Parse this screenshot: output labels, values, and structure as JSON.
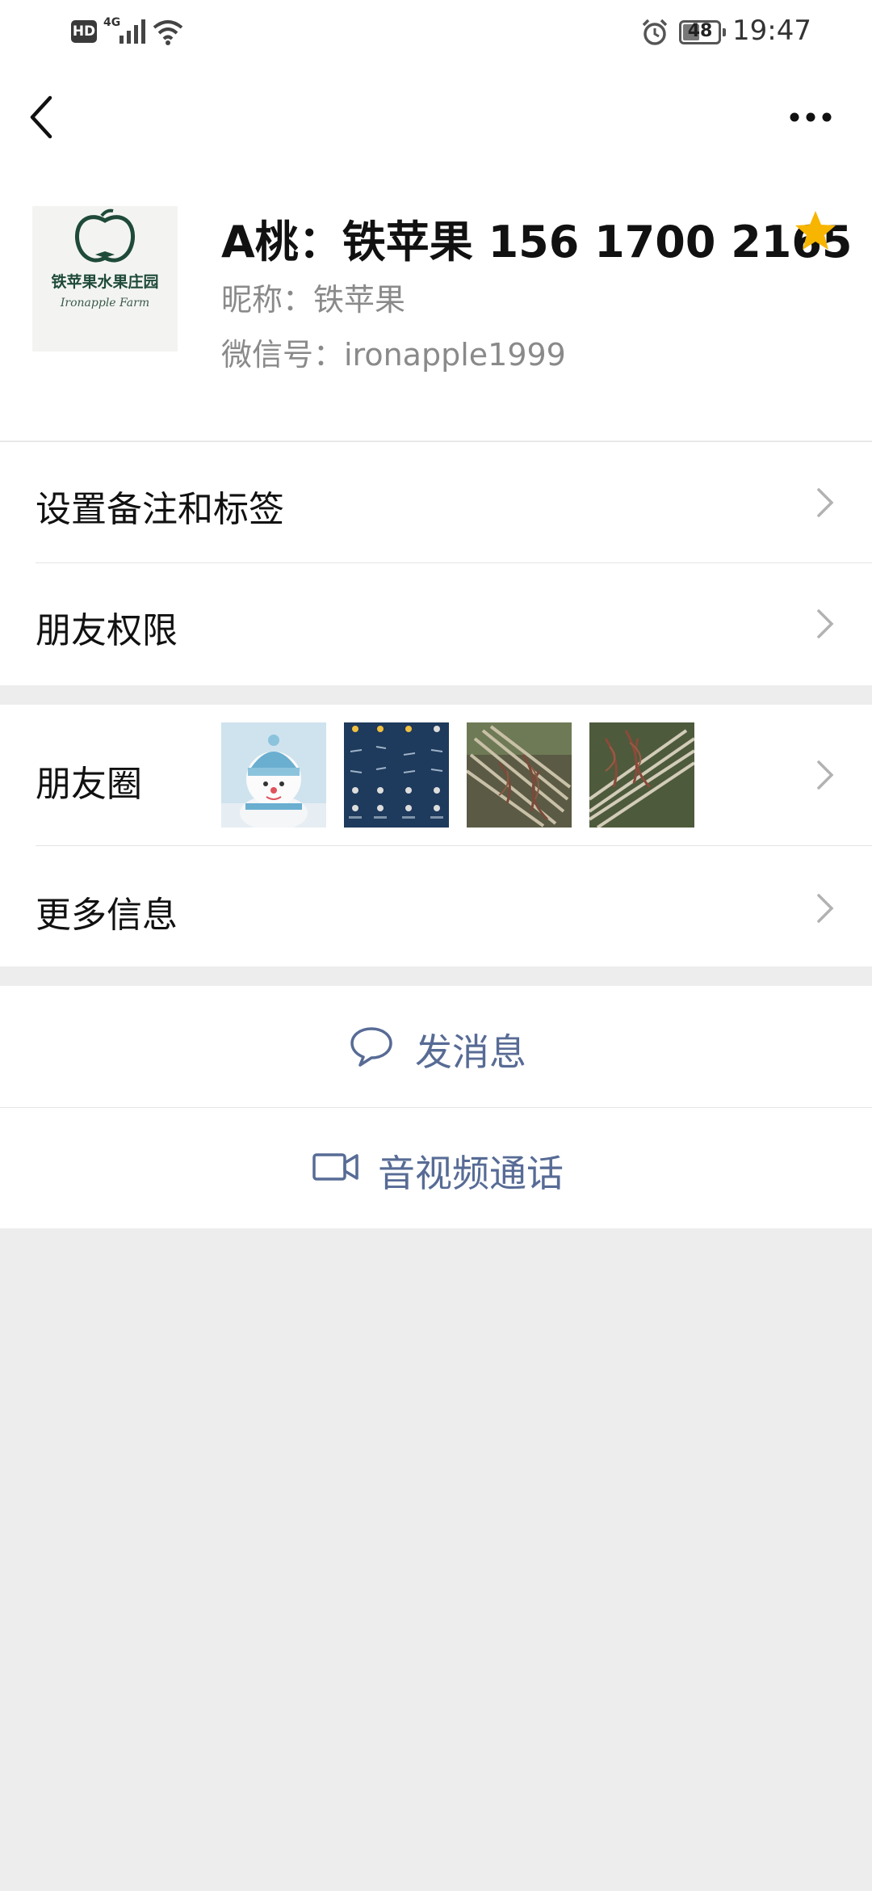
{
  "status_bar": {
    "hd_label": "HD",
    "network_label": "4G",
    "battery_level": "48",
    "battery_fraction": 0.48,
    "time": "19:47"
  },
  "nav": {
    "back_icon": "chevron-left-icon",
    "more_icon": "more-dots-icon"
  },
  "profile": {
    "avatar_text_line1": "铁苹果水果庄园",
    "avatar_text_line2": "Ironapple Farm",
    "name": "A桃：铁苹果 156 1700 2165",
    "star_color": "#f7b500",
    "nickname": "昵称：铁苹果",
    "wechat_id": "微信号：ironapple1999"
  },
  "menu": {
    "remark_tags": "设置备注和标签",
    "friend_permission": "朋友权限",
    "moments": "朋友圈",
    "more_info": "更多信息"
  },
  "moments_thumbnails": [
    "snowman-photo",
    "weather-forecast-screenshot",
    "seedling-roots-photo",
    "seedling-bundle-photo"
  ],
  "actions": {
    "send_message": "发消息",
    "video_call": "音视频通话"
  },
  "colors": {
    "link_blue": "#576b95",
    "background": "#ededed",
    "star_gold": "#f7b500"
  }
}
